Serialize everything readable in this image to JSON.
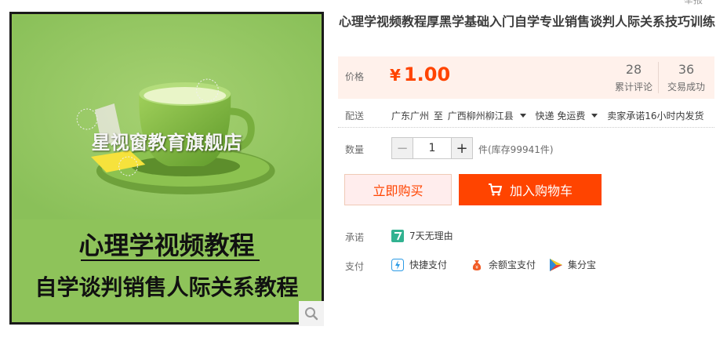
{
  "header": {
    "top_link": "举报"
  },
  "image": {
    "watermark": "星视窗教育旗舰店",
    "line1": "心理学视频教程",
    "line2": "自学谈判销售人际关系教程",
    "bg_color": "#8ec35a"
  },
  "product": {
    "title": "心理学视频教程厚黑学基础入门自学专业销售谈判人际关系技巧训练"
  },
  "price": {
    "label": "价格",
    "currency": "¥",
    "value": "1.00",
    "reviews_count": "28",
    "reviews_label": "累计评论",
    "sales_count": "36",
    "sales_label": "交易成功"
  },
  "delivery": {
    "label": "配送",
    "from": "广东广州",
    "to_label": "至",
    "to": "广西柳州柳江县",
    "shipping": "快递 免运费",
    "promise": "卖家承诺16小时内发货"
  },
  "quantity": {
    "label": "数量",
    "minus": "−",
    "value": "1",
    "plus": "+",
    "stock_text": "件(库存99941件)"
  },
  "actions": {
    "buy_now": "立即购买",
    "add_to_cart": "加入购物车"
  },
  "promise": {
    "label": "承诺",
    "item": "7天无理由"
  },
  "payment": {
    "label": "支付",
    "methods": [
      "快捷支付",
      "余额宝支付",
      "集分宝"
    ]
  },
  "colors": {
    "accent": "#ff4400",
    "price_bg": "#fff1eb"
  }
}
